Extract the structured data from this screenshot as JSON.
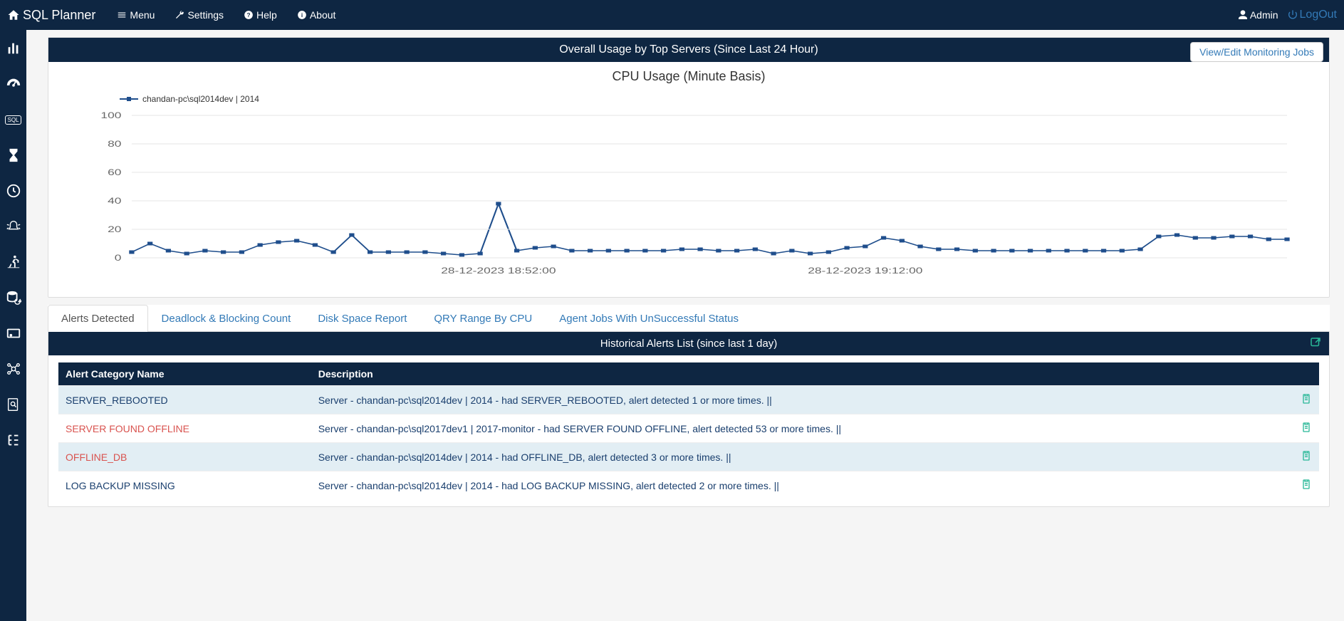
{
  "brand": "SQL Planner",
  "nav": {
    "menu": "Menu",
    "settings": "Settings",
    "help": "Help",
    "about": "About"
  },
  "user": {
    "name": "Admin",
    "logout": "LogOut"
  },
  "sidebar_icons": [
    "bars-icon",
    "gauge-icon",
    "sql-icon",
    "hourglass-icon",
    "clock-icon",
    "bell-icon",
    "run-icon",
    "db-refresh-icon",
    "disk-icon",
    "nodes-icon",
    "doc-search-icon",
    "tree-icon"
  ],
  "overview": {
    "title": "Overall Usage by Top Servers (Since Last 24 Hour)",
    "button": "View/Edit Monitoring Jobs"
  },
  "chart_data": {
    "type": "line",
    "title": "CPU Usage (Minute Basis)",
    "legend": "chandan-pc\\sql2014dev | 2014",
    "ylabel": "",
    "ylim": [
      0,
      100
    ],
    "yticks": [
      0,
      20,
      40,
      60,
      80,
      100
    ],
    "xticks": [
      "28-12-2023 18:52:00",
      "28-12-2023 19:12:00"
    ],
    "xtick_positions": [
      20,
      40
    ],
    "values": [
      4,
      10,
      5,
      3,
      5,
      4,
      4,
      9,
      11,
      12,
      9,
      4,
      16,
      4,
      4,
      4,
      4,
      3,
      2,
      3,
      38,
      5,
      7,
      8,
      5,
      5,
      5,
      5,
      5,
      5,
      6,
      6,
      5,
      5,
      6,
      3,
      5,
      3,
      4,
      7,
      8,
      14,
      12,
      8,
      6,
      6,
      5,
      5,
      5,
      5,
      5,
      5,
      5,
      5,
      5,
      6,
      15,
      16,
      14,
      14,
      15,
      15,
      13,
      13
    ]
  },
  "tabs": {
    "items": [
      "Alerts Detected",
      "Deadlock & Blocking Count",
      "Disk Space Report",
      "QRY Range By CPU",
      "Agent Jobs With UnSuccessful Status"
    ],
    "active": 0
  },
  "alerts_panel": {
    "title": "Historical Alerts List (since last 1 day)"
  },
  "table": {
    "headers": [
      "Alert Category Name",
      "Description"
    ],
    "rows": [
      {
        "cat": "SERVER_REBOOTED",
        "cat_color": "normal",
        "desc": "Server - chandan-pc\\sql2014dev | 2014 - had SERVER_REBOOTED, alert detected 1 or more times. ||"
      },
      {
        "cat": "SERVER FOUND OFFLINE",
        "cat_color": "red",
        "desc": "Server - chandan-pc\\sql2017dev1 | 2017-monitor - had SERVER FOUND OFFLINE, alert detected 53 or more times. ||"
      },
      {
        "cat": "OFFLINE_DB",
        "cat_color": "red",
        "desc": "Server - chandan-pc\\sql2014dev | 2014 - had OFFLINE_DB, alert detected 3 or more times. ||"
      },
      {
        "cat": "LOG BACKUP MISSING",
        "cat_color": "normal",
        "desc": "Server - chandan-pc\\sql2014dev | 2014 - had LOG BACKUP MISSING, alert detected 2 or more times. ||"
      }
    ]
  }
}
